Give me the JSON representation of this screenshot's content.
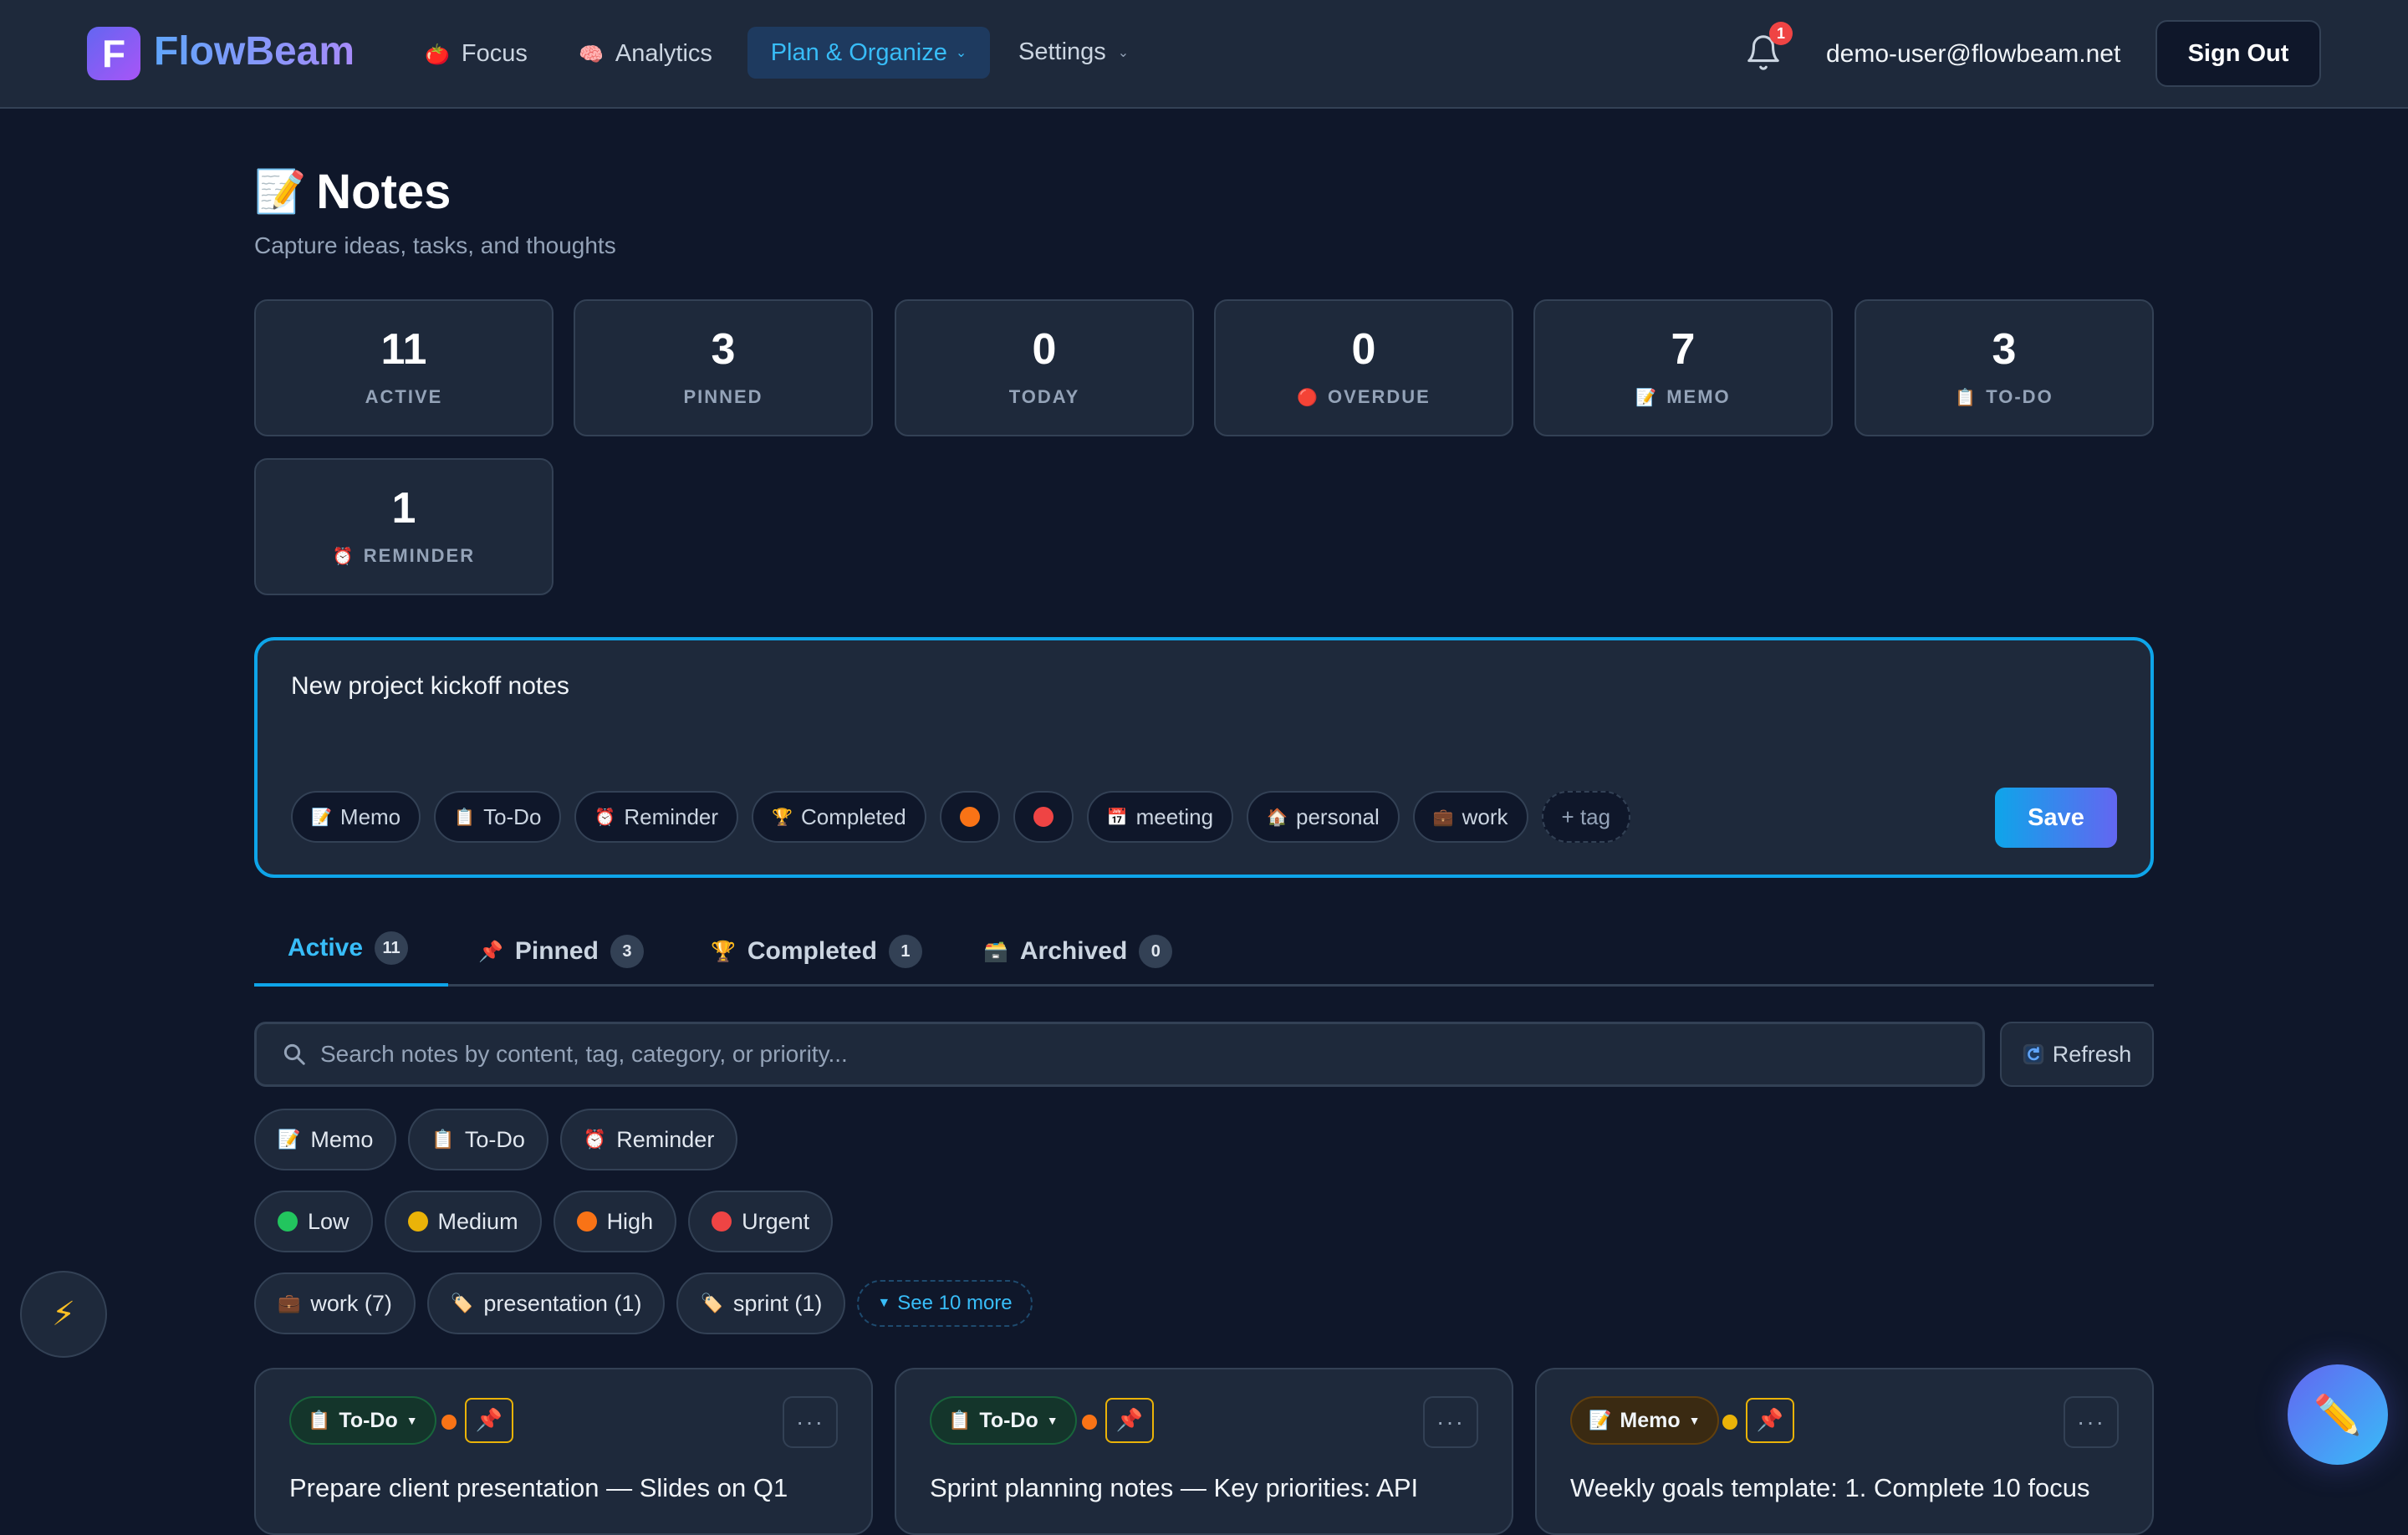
{
  "brand": {
    "logo_letter": "F",
    "name": "FlowBeam"
  },
  "nav": {
    "focus": {
      "icon": "🍅",
      "label": "Focus"
    },
    "analytics": {
      "icon": "🧠",
      "label": "Analytics"
    },
    "plan": {
      "label": "Plan & Organize"
    },
    "settings": {
      "label": "Settings"
    }
  },
  "notifications": {
    "count": "1"
  },
  "user": {
    "email": "demo-user@flowbeam.net",
    "signout": "Sign Out"
  },
  "page": {
    "icon": "📝",
    "title": "Notes",
    "subtitle": "Capture ideas, tasks, and thoughts"
  },
  "stats": [
    {
      "value": "11",
      "icon": "",
      "label": "ACTIVE"
    },
    {
      "value": "3",
      "icon": "",
      "label": "PINNED"
    },
    {
      "value": "0",
      "icon": "",
      "label": "TODAY"
    },
    {
      "value": "0",
      "icon": "🔴",
      "label": "OVERDUE"
    },
    {
      "value": "7",
      "icon": "📝",
      "label": "MEMO"
    },
    {
      "value": "3",
      "icon": "📋",
      "label": "TO-DO"
    },
    {
      "value": "1",
      "icon": "⏰",
      "label": "REMINDER"
    }
  ],
  "composer": {
    "text": "New project kickoff notes",
    "chips": [
      {
        "icon": "📝",
        "label": "Memo"
      },
      {
        "icon": "📋",
        "label": "To-Do"
      },
      {
        "icon": "⏰",
        "label": "Reminder"
      },
      {
        "icon": "🏆",
        "label": "Completed"
      },
      {
        "icon": "🟠",
        "label": ""
      },
      {
        "icon": "🔴",
        "label": ""
      },
      {
        "icon": "📅",
        "label": "meeting"
      },
      {
        "icon": "🏠",
        "label": "personal"
      },
      {
        "icon": "💼",
        "label": "work"
      }
    ],
    "add_tag": "+ tag",
    "save": "Save"
  },
  "tabs": [
    {
      "icon": "",
      "label": "Active",
      "count": "11"
    },
    {
      "icon": "📌",
      "label": "Pinned",
      "count": "3"
    },
    {
      "icon": "🏆",
      "label": "Completed",
      "count": "1"
    },
    {
      "icon": "🗃️",
      "label": "Archived",
      "count": "0"
    }
  ],
  "search": {
    "placeholder": "Search notes by content, tag, category, or priority...",
    "refresh": "Refresh"
  },
  "filters": {
    "types": [
      {
        "icon": "📝",
        "label": "Memo"
      },
      {
        "icon": "📋",
        "label": "To-Do"
      },
      {
        "icon": "⏰",
        "label": "Reminder"
      }
    ],
    "priorities": [
      {
        "color": "#22c55e",
        "label": "Low"
      },
      {
        "color": "#eab308",
        "label": "Medium"
      },
      {
        "color": "#f97316",
        "label": "High"
      },
      {
        "color": "#ef4444",
        "label": "Urgent"
      }
    ],
    "tags": [
      {
        "icon": "💼",
        "label": "work (7)"
      },
      {
        "icon": "🏷️",
        "label": "presentation (1)"
      },
      {
        "icon": "🏷️",
        "label": "sprint (1)"
      }
    ],
    "see_more": "See 10 more"
  },
  "cards": [
    {
      "type": "To-Do",
      "type_icon": "📋",
      "priority_color": "#f97316",
      "title": "Prepare client presentation — Slides on Q1"
    },
    {
      "type": "To-Do",
      "type_icon": "📋",
      "priority_color": "#f97316",
      "title": "Sprint planning notes — Key priorities: API"
    },
    {
      "type": "Memo",
      "type_icon": "📝",
      "priority_color": "#eab308",
      "title": "Weekly goals template: 1. Complete 10 focus"
    }
  ]
}
